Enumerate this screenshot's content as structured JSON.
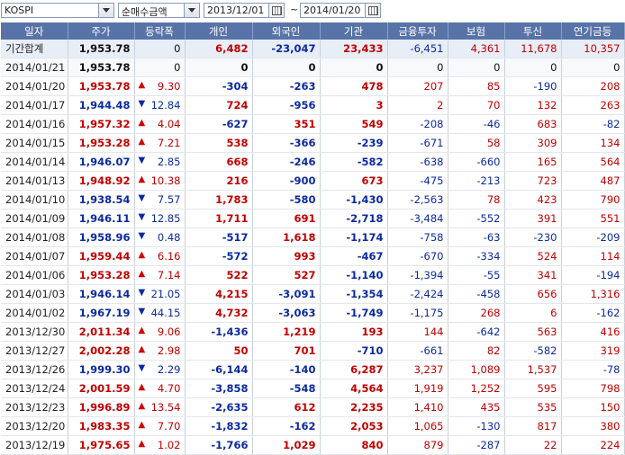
{
  "toolbar": {
    "index_select": "KOSPI",
    "mode_select": "순매수금액",
    "start_date": "2013/12/01",
    "end_date": "2014/01/20",
    "range_sep": "~"
  },
  "columns": [
    "일자",
    "주가",
    "등락폭",
    "개인",
    "외국인",
    "기관",
    "금융투자",
    "보험",
    "투신",
    "연기금등"
  ],
  "total_row": {
    "date": "기간합계",
    "price": "1,953.78",
    "chg": "0",
    "dir": "",
    "indiv": "6,482",
    "foreign": "-23,047",
    "inst": "23,433",
    "fin": "-6,451",
    "ins": "4,361",
    "trust": "11,678",
    "pension": "10,357"
  },
  "rows": [
    {
      "date": "2014/01/21",
      "price": "1,953.78",
      "chg": "0",
      "dir": "",
      "indiv": "0",
      "foreign": "0",
      "inst": "0",
      "fin": "0",
      "ins": "0",
      "trust": "0",
      "pension": "0"
    },
    {
      "date": "2014/01/20",
      "price": "1,953.78",
      "chg": "9.30",
      "dir": "up",
      "indiv": "-304",
      "foreign": "-263",
      "inst": "478",
      "fin": "207",
      "ins": "85",
      "trust": "-190",
      "pension": "208"
    },
    {
      "date": "2014/01/17",
      "price": "1,944.48",
      "chg": "12.84",
      "dir": "dn",
      "indiv": "724",
      "foreign": "-956",
      "inst": "3",
      "fin": "2",
      "ins": "70",
      "trust": "132",
      "pension": "263"
    },
    {
      "date": "2014/01/16",
      "price": "1,957.32",
      "chg": "4.04",
      "dir": "up",
      "indiv": "-627",
      "foreign": "351",
      "inst": "549",
      "fin": "-208",
      "ins": "-46",
      "trust": "683",
      "pension": "-82"
    },
    {
      "date": "2014/01/15",
      "price": "1,953.28",
      "chg": "7.21",
      "dir": "up",
      "indiv": "538",
      "foreign": "-366",
      "inst": "-239",
      "fin": "-671",
      "ins": "58",
      "trust": "309",
      "pension": "134"
    },
    {
      "date": "2014/01/14",
      "price": "1,946.07",
      "chg": "2.85",
      "dir": "dn",
      "indiv": "668",
      "foreign": "-246",
      "inst": "-582",
      "fin": "-638",
      "ins": "-660",
      "trust": "165",
      "pension": "564"
    },
    {
      "date": "2014/01/13",
      "price": "1,948.92",
      "chg": "10.38",
      "dir": "up",
      "indiv": "216",
      "foreign": "-900",
      "inst": "673",
      "fin": "-475",
      "ins": "-213",
      "trust": "723",
      "pension": "487"
    },
    {
      "date": "2014/01/10",
      "price": "1,938.54",
      "chg": "7.57",
      "dir": "dn",
      "indiv": "1,783",
      "foreign": "-580",
      "inst": "-1,430",
      "fin": "-2,563",
      "ins": "78",
      "trust": "423",
      "pension": "790"
    },
    {
      "date": "2014/01/09",
      "price": "1,946.11",
      "chg": "12.85",
      "dir": "dn",
      "indiv": "1,711",
      "foreign": "691",
      "inst": "-2,718",
      "fin": "-3,484",
      "ins": "-552",
      "trust": "391",
      "pension": "551"
    },
    {
      "date": "2014/01/08",
      "price": "1,958.96",
      "chg": "0.48",
      "dir": "dn",
      "indiv": "-517",
      "foreign": "1,618",
      "inst": "-1,174",
      "fin": "-758",
      "ins": "-63",
      "trust": "-230",
      "pension": "-209"
    },
    {
      "date": "2014/01/07",
      "price": "1,959.44",
      "chg": "6.16",
      "dir": "up",
      "indiv": "-572",
      "foreign": "993",
      "inst": "-467",
      "fin": "-670",
      "ins": "-334",
      "trust": "524",
      "pension": "114"
    },
    {
      "date": "2014/01/06",
      "price": "1,953.28",
      "chg": "7.14",
      "dir": "up",
      "indiv": "522",
      "foreign": "527",
      "inst": "-1,140",
      "fin": "-1,394",
      "ins": "-55",
      "trust": "341",
      "pension": "-194"
    },
    {
      "date": "2014/01/03",
      "price": "1,946.14",
      "chg": "21.05",
      "dir": "dn",
      "indiv": "4,215",
      "foreign": "-3,091",
      "inst": "-1,354",
      "fin": "-2,424",
      "ins": "-458",
      "trust": "656",
      "pension": "1,316"
    },
    {
      "date": "2014/01/02",
      "price": "1,967.19",
      "chg": "44.15",
      "dir": "dn",
      "indiv": "4,732",
      "foreign": "-3,063",
      "inst": "-1,749",
      "fin": "-1,175",
      "ins": "268",
      "trust": "6",
      "pension": "-162"
    },
    {
      "date": "2013/12/30",
      "price": "2,011.34",
      "chg": "9.06",
      "dir": "up",
      "indiv": "-1,436",
      "foreign": "1,219",
      "inst": "193",
      "fin": "144",
      "ins": "-642",
      "trust": "563",
      "pension": "416"
    },
    {
      "date": "2013/12/27",
      "price": "2,002.28",
      "chg": "2.98",
      "dir": "up",
      "indiv": "50",
      "foreign": "701",
      "inst": "-710",
      "fin": "-661",
      "ins": "82",
      "trust": "-582",
      "pension": "319"
    },
    {
      "date": "2013/12/26",
      "price": "1,999.30",
      "chg": "2.29",
      "dir": "dn",
      "indiv": "-6,144",
      "foreign": "-140",
      "inst": "6,287",
      "fin": "3,237",
      "ins": "1,089",
      "trust": "1,537",
      "pension": "-78"
    },
    {
      "date": "2013/12/24",
      "price": "2,001.59",
      "chg": "4.70",
      "dir": "up",
      "indiv": "-3,858",
      "foreign": "-548",
      "inst": "4,564",
      "fin": "1,919",
      "ins": "1,252",
      "trust": "595",
      "pension": "798"
    },
    {
      "date": "2013/12/23",
      "price": "1,996.89",
      "chg": "13.54",
      "dir": "up",
      "indiv": "-2,635",
      "foreign": "612",
      "inst": "2,235",
      "fin": "1,410",
      "ins": "435",
      "trust": "535",
      "pension": "150"
    },
    {
      "date": "2013/12/20",
      "price": "1,983.35",
      "chg": "7.70",
      "dir": "up",
      "indiv": "-1,832",
      "foreign": "-162",
      "inst": "2,053",
      "fin": "1,065",
      "ins": "-130",
      "trust": "817",
      "pension": "380"
    },
    {
      "date": "2013/12/19",
      "price": "1,975.65",
      "chg": "1.02",
      "dir": "up",
      "indiv": "-1,766",
      "foreign": "1,029",
      "inst": "840",
      "fin": "879",
      "ins": "-287",
      "trust": "22",
      "pension": "224"
    }
  ],
  "icons": {
    "up": "▲",
    "dn": "▼"
  },
  "colors": {
    "header": "#5873a8",
    "up": "#c00000",
    "down": "#0b2aa0",
    "total_bg": "#e8eef7"
  }
}
